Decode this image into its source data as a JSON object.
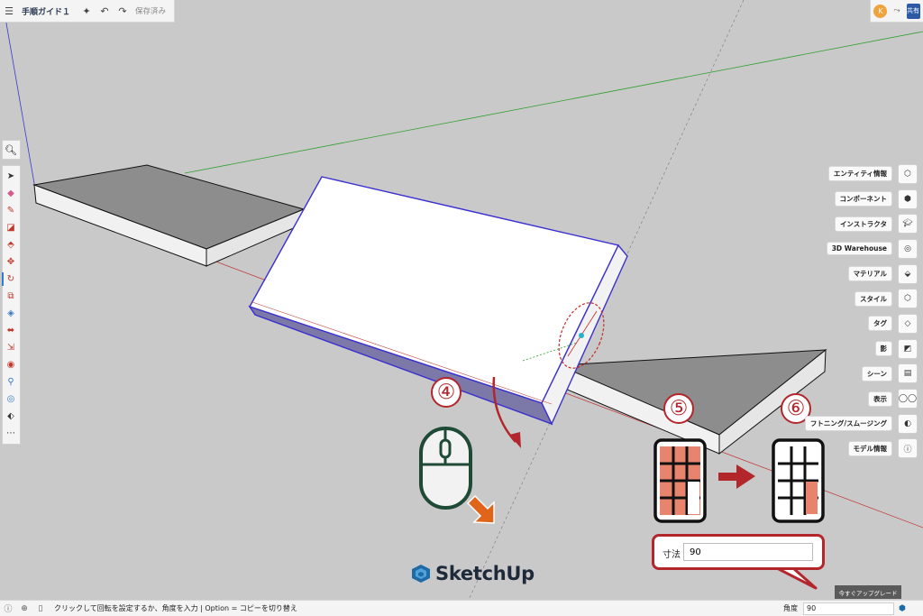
{
  "header": {
    "title": "手順ガイド１",
    "saved_status": "保存済み",
    "avatar_initial": "K",
    "share_label": "共有"
  },
  "right_panel": {
    "items": [
      {
        "label": "エンティティ情報",
        "icon": "entity-info-icon"
      },
      {
        "label": "コンポーネント",
        "icon": "components-icon"
      },
      {
        "label": "インストラクタ",
        "icon": "instructor-icon"
      },
      {
        "label": "3D Warehouse",
        "icon": "warehouse-icon"
      },
      {
        "label": "マテリアル",
        "icon": "materials-icon"
      },
      {
        "label": "スタイル",
        "icon": "styles-icon"
      },
      {
        "label": "タグ",
        "icon": "tags-icon"
      },
      {
        "label": "影",
        "icon": "shadows-icon"
      },
      {
        "label": "シーン",
        "icon": "scenes-icon"
      },
      {
        "label": "表示",
        "icon": "display-icon"
      },
      {
        "label": "フトニング/スムージング",
        "icon": "soften-smooth-icon"
      },
      {
        "label": "モデル情報",
        "icon": "model-info-icon"
      }
    ]
  },
  "status": {
    "hint": "クリックして回転を設定するか、角度を入力 | Option = コピーを切り替え",
    "angle_label": "角度",
    "angle_value": "90",
    "upgrade_label": "今すぐアップグレード"
  },
  "callout": {
    "label": "寸法",
    "value": "90"
  },
  "steps": {
    "step4": "④",
    "step5": "⑤",
    "step6": "⑥"
  },
  "logo": {
    "text": "SketchUp"
  },
  "colors": {
    "accent_red": "#b3262c",
    "key_orange": "#e8836e",
    "mouse_green": "#1f4a36",
    "axis_green": "#2ea02e",
    "axis_blue": "#3a3ad0",
    "axis_red": "#c04040",
    "selection_blue": "#3b2fd0"
  }
}
